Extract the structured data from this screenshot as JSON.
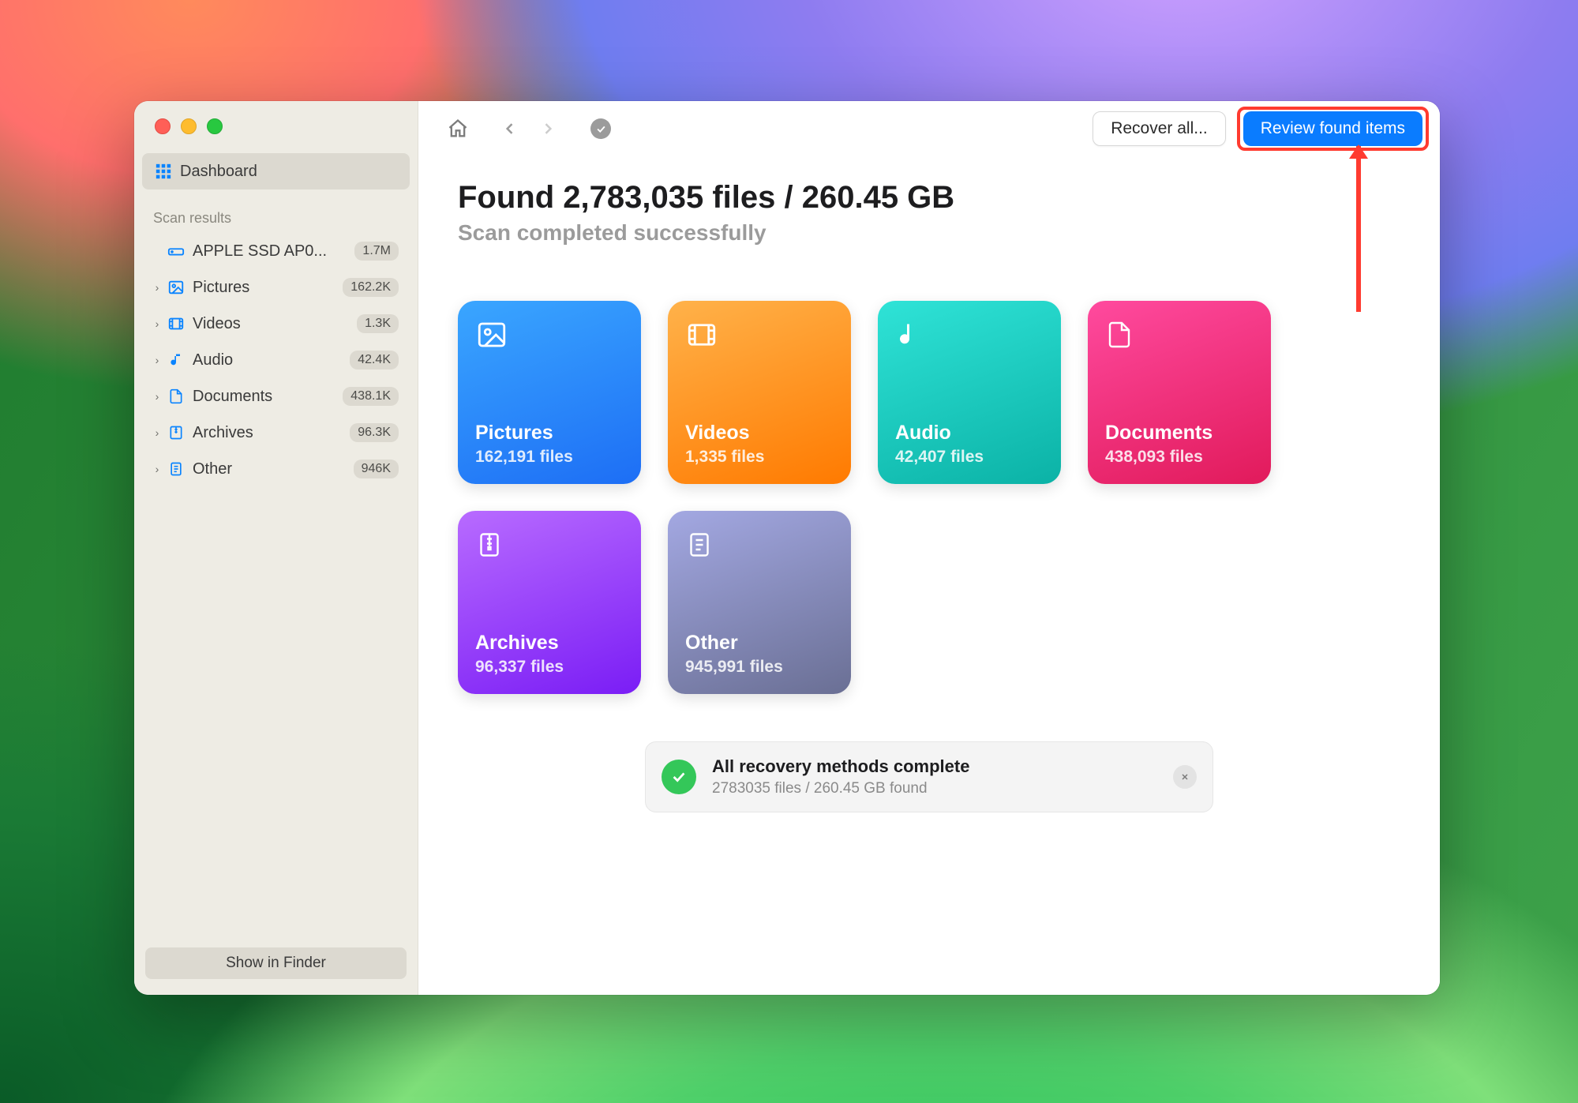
{
  "sidebar": {
    "dashboard": "Dashboard",
    "section_label": "Scan results",
    "drive": {
      "name": "APPLE SSD AP0...",
      "badge": "1.7M"
    },
    "categories": [
      {
        "icon": "picture",
        "label": "Pictures",
        "badge": "162.2K"
      },
      {
        "icon": "video",
        "label": "Videos",
        "badge": "1.3K"
      },
      {
        "icon": "audio",
        "label": "Audio",
        "badge": "42.4K"
      },
      {
        "icon": "doc",
        "label": "Documents",
        "badge": "438.1K"
      },
      {
        "icon": "archive",
        "label": "Archives",
        "badge": "96.3K"
      },
      {
        "icon": "other",
        "label": "Other",
        "badge": "946K"
      }
    ],
    "show_in_finder": "Show in Finder"
  },
  "toolbar": {
    "recover_all": "Recover all...",
    "review_found": "Review found items"
  },
  "header": {
    "headline": "Found 2,783,035 files / 260.45 GB",
    "subhead": "Scan completed successfully"
  },
  "cards": {
    "pictures": {
      "title": "Pictures",
      "sub": "162,191 files"
    },
    "videos": {
      "title": "Videos",
      "sub": "1,335 files"
    },
    "audio": {
      "title": "Audio",
      "sub": "42,407 files"
    },
    "documents": {
      "title": "Documents",
      "sub": "438,093 files"
    },
    "archives": {
      "title": "Archives",
      "sub": "96,337 files"
    },
    "other": {
      "title": "Other",
      "sub": "945,991 files"
    }
  },
  "toast": {
    "title": "All recovery methods complete",
    "detail": "2783035 files / 260.45 GB found"
  }
}
